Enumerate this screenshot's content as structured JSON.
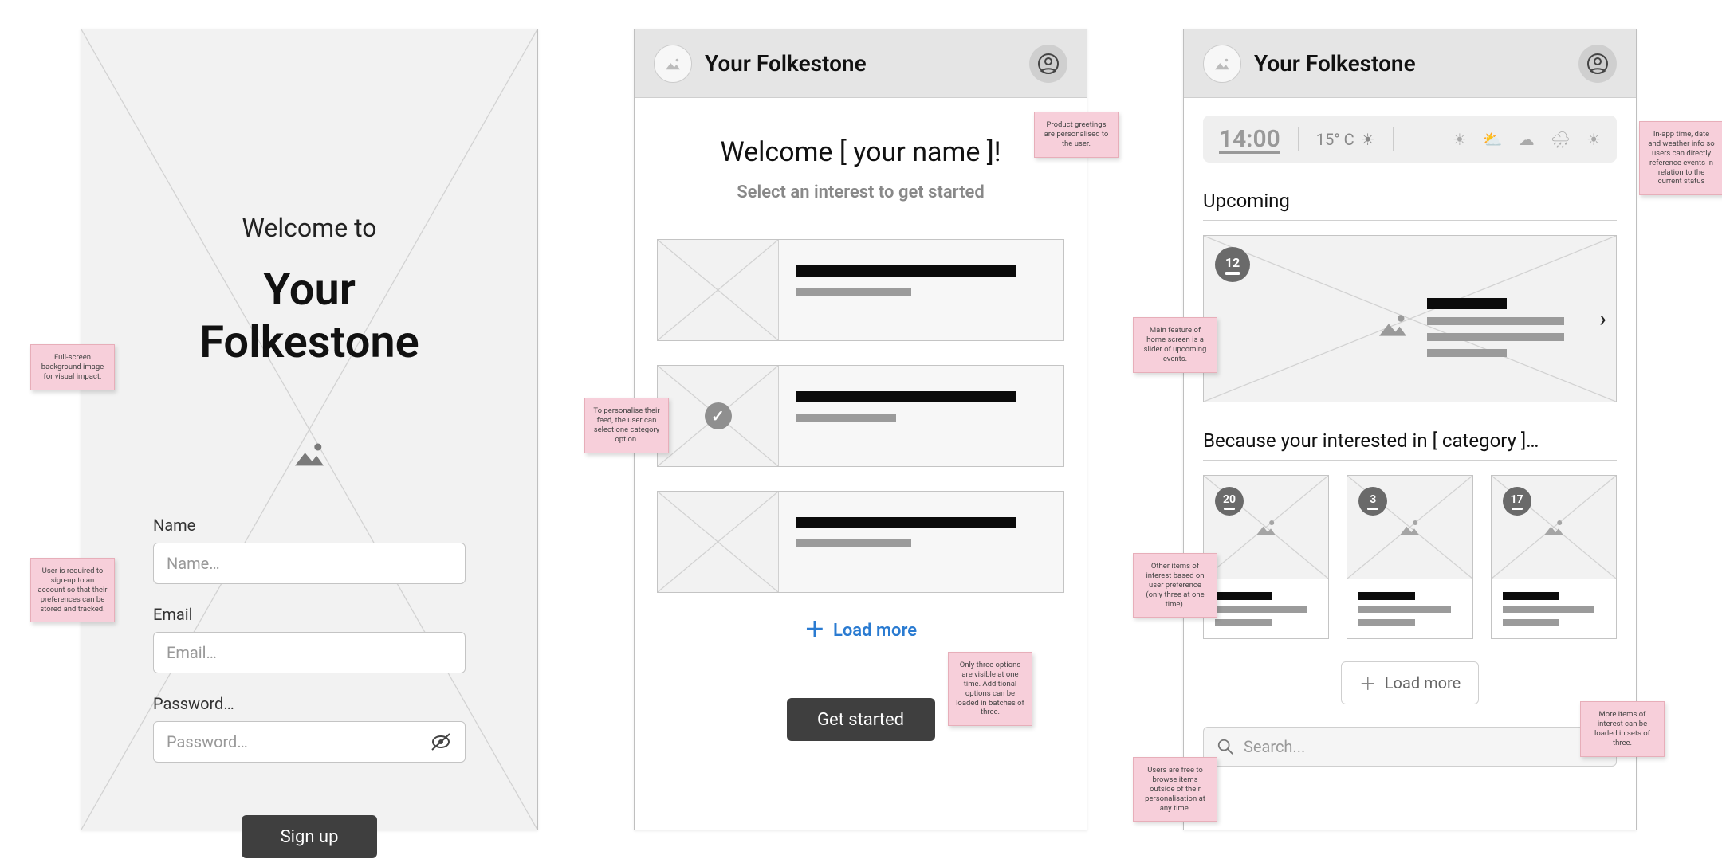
{
  "frame1": {
    "welcome": "Welcome to",
    "title": "Your Folkestone",
    "labels": {
      "name": "Name",
      "email": "Email",
      "password": "Password…"
    },
    "placeholders": {
      "name": "Name…",
      "email": "Email…",
      "password": "Password…"
    },
    "signup_btn": "Sign up"
  },
  "frame2": {
    "header_title": "Your Folkestone",
    "welcome": "Welcome [ your name ]!",
    "subtitle": "Select an interest to get started",
    "load_more": "Load more",
    "get_started": "Get started"
  },
  "frame3": {
    "header_title": "Your Folkestone",
    "status": {
      "time": "14:00",
      "temp": "15° C",
      "temp_icon": "☀"
    },
    "upcoming_title": "Upcoming",
    "hero_badge": "12",
    "because_title": "Because your interested in [ category ]…",
    "tile_badges": [
      "20",
      "3",
      "17"
    ],
    "load_more": "Load more",
    "search_placeholder": "Search..."
  },
  "notes": {
    "n1": "Full-screen background image for visual impact.",
    "n2": "User is required to sign-up to an account so that their preferences can be stored and tracked.",
    "n3": "To personalise their feed, the user can select one category option.",
    "n4": "Product greetings are personalised to the user.",
    "n5": "Only three options are visible at one time. Additional options can be loaded in batches of three.",
    "n6": "Main feature of home screen is a slider of upcoming events.",
    "n7": "Other items of interest based on user preference (only three at one time).",
    "n8": "Users are free to browse items outside of their personalisation at any time.",
    "n9": "In-app time, date and weather info so users can directly reference events in relation to the current status",
    "n10": "More items of interest can be loaded in sets of three."
  }
}
